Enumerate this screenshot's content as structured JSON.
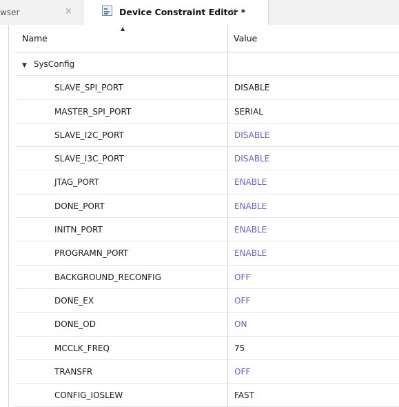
{
  "tabs": [
    {
      "label": "wser",
      "active": false,
      "close": "×"
    },
    {
      "label": "Device Constraint Editor *",
      "active": true,
      "close": "×"
    }
  ],
  "table": {
    "columns": [
      "Name",
      "Value"
    ],
    "sort_indicator": "▲",
    "group": {
      "label": "SysConfig",
      "expanded": true,
      "expander": "▼"
    },
    "rows": [
      {
        "name": "SLAVE_SPI_PORT",
        "value": "DISABLE",
        "style": "black"
      },
      {
        "name": "MASTER_SPI_PORT",
        "value": "SERIAL",
        "style": "black"
      },
      {
        "name": "SLAVE_I2C_PORT",
        "value": "DISABLE",
        "style": "purple"
      },
      {
        "name": "SLAVE_I3C_PORT",
        "value": "DISABLE",
        "style": "purple"
      },
      {
        "name": "JTAG_PORT",
        "value": "ENABLE",
        "style": "purple"
      },
      {
        "name": "DONE_PORT",
        "value": "ENABLE",
        "style": "purple"
      },
      {
        "name": "INITN_PORT",
        "value": "ENABLE",
        "style": "purple"
      },
      {
        "name": "PROGRAMN_PORT",
        "value": "ENABLE",
        "style": "purple"
      },
      {
        "name": "BACKGROUND_RECONFIG",
        "value": "OFF",
        "style": "purple"
      },
      {
        "name": "DONE_EX",
        "value": "OFF",
        "style": "purple"
      },
      {
        "name": "DONE_OD",
        "value": "ON",
        "style": "purple"
      },
      {
        "name": "MCCLK_FREQ",
        "value": "75",
        "style": "black"
      },
      {
        "name": "TRANSFR",
        "value": "OFF",
        "style": "purple"
      },
      {
        "name": "CONFIG_IOSLEW",
        "value": "FAST",
        "style": "black"
      }
    ]
  },
  "colors": {
    "default_value": "#1a1a1a",
    "default_value_purple": "#6c5fc7",
    "grid_line": "#d6d6d6",
    "tab_bar": "#f2f2f2"
  },
  "icons": {
    "editor_tab_icon": "constraint-editor-icon",
    "close": "close-icon",
    "expand": "chevron-down-icon",
    "sort": "sort-ascending-icon"
  }
}
